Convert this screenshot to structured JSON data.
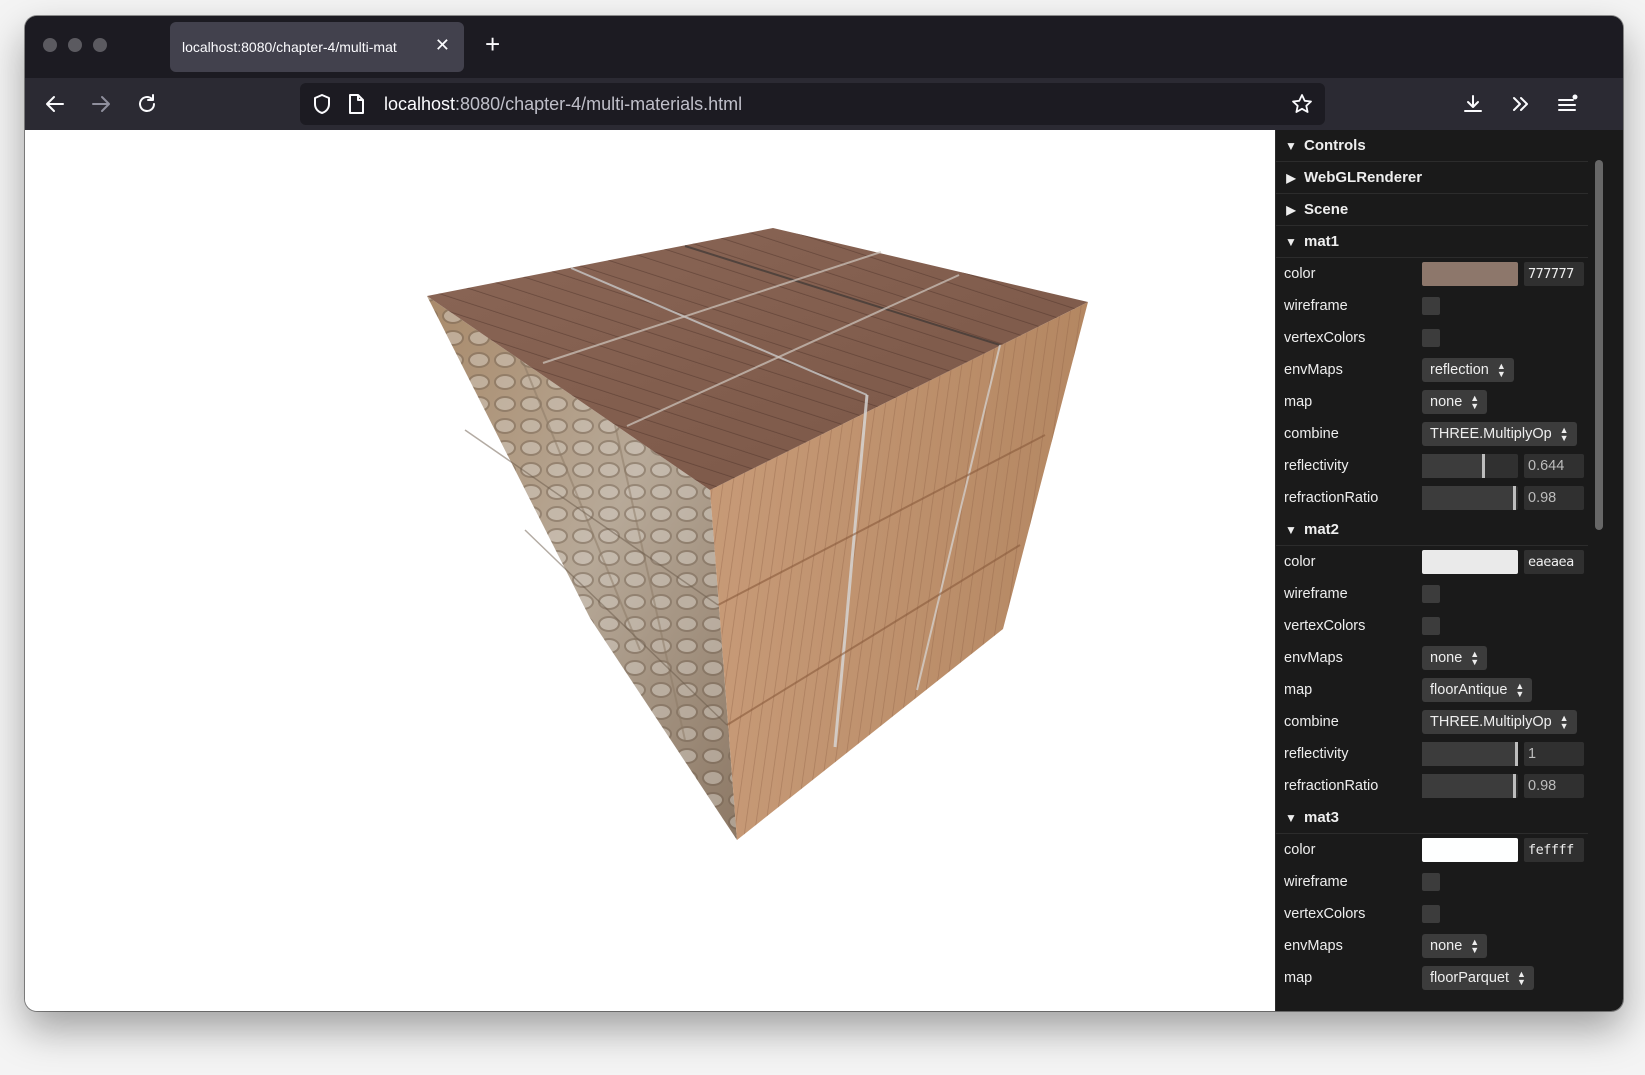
{
  "browser": {
    "tab_title": "localhost:8080/chapter-4/multi-mat",
    "url_host": "localhost",
    "url_path": ":8080/chapter-4/multi-materials.html"
  },
  "gui": {
    "controls_title": "Controls",
    "collapsed_folders": [
      "WebGLRenderer",
      "Scene"
    ],
    "materials": [
      {
        "name": "mat1",
        "color_hex": "777777",
        "swatch_color": "#8d776b",
        "wireframe_label": "wireframe",
        "vertexColors_label": "vertexColors",
        "envMaps_label": "envMaps",
        "envMaps_value": "reflection",
        "map_label": "map",
        "map_value": "none",
        "combine_label": "combine",
        "combine_value": "THREE.MultiplyOp",
        "reflectivity_label": "reflectivity",
        "reflectivity_value": "0.644",
        "reflectivity_fraction": 0.644,
        "refractionRatio_label": "refractionRatio",
        "refractionRatio_value": "0.98",
        "refractionRatio_fraction": 0.98,
        "color_label": "color"
      },
      {
        "name": "mat2",
        "color_hex": "eaeaea",
        "swatch_color": "#eaeaea",
        "wireframe_label": "wireframe",
        "vertexColors_label": "vertexColors",
        "envMaps_label": "envMaps",
        "envMaps_value": "none",
        "map_label": "map",
        "map_value": "floorAntique",
        "combine_label": "combine",
        "combine_value": "THREE.MultiplyOp",
        "reflectivity_label": "reflectivity",
        "reflectivity_value": "1",
        "reflectivity_fraction": 1,
        "refractionRatio_label": "refractionRatio",
        "refractionRatio_value": "0.98",
        "refractionRatio_fraction": 0.98,
        "color_label": "color"
      },
      {
        "name": "mat3",
        "color_hex": "feffff",
        "swatch_color": "#feffff",
        "wireframe_label": "wireframe",
        "vertexColors_label": "vertexColors",
        "envMaps_label": "envMaps",
        "envMaps_value": "none",
        "map_label": "map",
        "map_value": "floorParquet",
        "color_label": "color"
      }
    ]
  },
  "colors": {
    "browser_bg": "#1c1b22",
    "toolbar_bg": "#2b2a33",
    "gui_bg": "#1a1a1a"
  }
}
